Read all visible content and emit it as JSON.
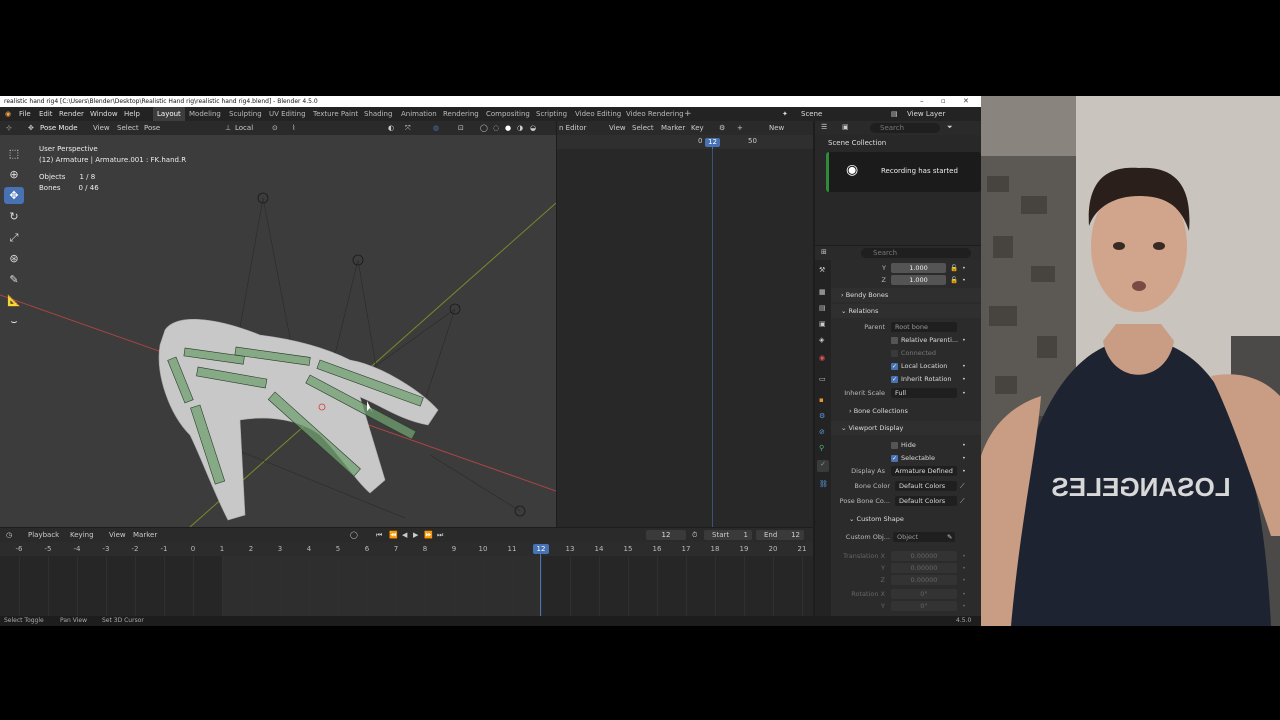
{
  "window": {
    "title": "realistic hand rig4 [C:\\Users\\Blender\\Desktop\\Realistic Hand rig\\realistic hand rig4.blend] - Blender 4.5.0"
  },
  "menu": {
    "items": [
      "File",
      "Edit",
      "Render",
      "Window",
      "Help"
    ]
  },
  "workspaces": [
    "Layout",
    "Modeling",
    "Sculpting",
    "UV Editing",
    "Texture Paint",
    "Shading",
    "Animation",
    "Rendering",
    "Compositing",
    "Scripting",
    "Video Editing",
    "Video Rendering"
  ],
  "topbar_right": {
    "scene": "Scene",
    "view_layer": "View Layer"
  },
  "viewport": {
    "mode": "Pose Mode",
    "menus": [
      "View",
      "Select",
      "Pose"
    ],
    "orientation": "Local",
    "info": {
      "perspective": "User Perspective",
      "active": "(12) Armature | Armature.001 : FK.hand.R",
      "objects_label": "Objects",
      "objects_value": "1 / 8",
      "bones_label": "Bones",
      "bones_value": "0 / 46"
    }
  },
  "dopesheet": {
    "editor": "n Editor",
    "menus": [
      "View",
      "Select",
      "Marker",
      "Key"
    ],
    "new_label": "New",
    "frame_start_label": "0",
    "current_frame": "12",
    "frame_mark": "50"
  },
  "outliner": {
    "search_placeholder": "Search",
    "scene_collection": "Scene Collection",
    "toast": "Recording has started"
  },
  "properties": {
    "search_placeholder": "Search",
    "y_label": "Y",
    "y_value": "1.000",
    "z_label": "Z",
    "z_value": "1.000",
    "bendy_bones": "Bendy Bones",
    "relations": "Relations",
    "parent_label": "Parent",
    "parent_placeholder": "Root bone",
    "relative_parenting": "Relative Parenti...",
    "connected": "Connected",
    "local_location": "Local Location",
    "inherit_rotation": "Inherit Rotation",
    "inherit_scale_label": "Inherit Scale",
    "inherit_scale_value": "Full",
    "bone_collections": "Bone Collections",
    "viewport_display": "Viewport Display",
    "hide": "Hide",
    "selectable": "Selectable",
    "display_as_label": "Display As",
    "display_as_value": "Armature Defined",
    "bone_color_label": "Bone Color",
    "bone_color_value": "Default Colors",
    "pose_bone_color_label": "Pose Bone Co...",
    "pose_bone_color_value": "Default Colors",
    "custom_shape": "Custom Shape",
    "custom_object_label": "Custom Obj...",
    "custom_object_placeholder": "Object",
    "translation_x_label": "Translation X",
    "translation_x": "0.00000",
    "translation_y_label": "Y",
    "translation_y": "0.00000",
    "translation_z_label": "Z",
    "translation_z": "0.00000",
    "rotation_x_label": "Rotation X",
    "rotation_x": "0°",
    "rotation_y_label": "Y",
    "rotation_y": "0°"
  },
  "timeline": {
    "menus": [
      "Playback",
      "Keying",
      "View",
      "Marker"
    ],
    "current_frame": "12",
    "start_label": "Start",
    "start_value": "1",
    "end_label": "End",
    "end_value": "12",
    "ticks": [
      "-6",
      "-5",
      "-4",
      "-3",
      "-2",
      "-1",
      "0",
      "1",
      "2",
      "3",
      "4",
      "5",
      "6",
      "7",
      "8",
      "9",
      "10",
      "11",
      "12",
      "13",
      "14",
      "15",
      "16",
      "17",
      "18",
      "19",
      "20",
      "21"
    ],
    "active_tick": "12"
  },
  "status": {
    "items": [
      "Select Toggle",
      "Pan View",
      "Set 3D Cursor"
    ],
    "version": "4.5.0"
  },
  "webcam": {
    "shirt_text": "LOSANGELES"
  },
  "colors": {
    "accent": "#4772b3",
    "bg": "#1d1d1d",
    "viewport": "#3c3c3c",
    "playhead": "#4772b3"
  }
}
